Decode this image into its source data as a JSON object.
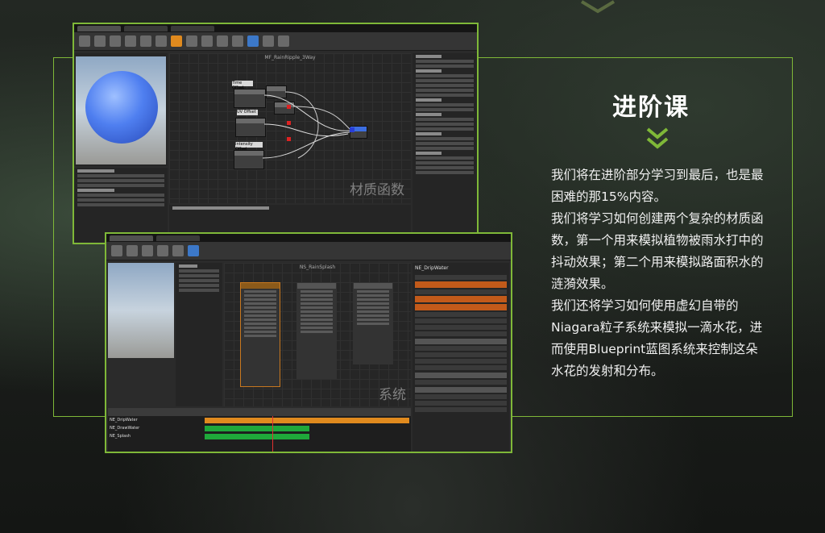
{
  "heading": {
    "title": "进阶课",
    "paragraphs": [
      "我们将在进阶部分学习到最后，也是最困难的那15%内容。",
      "我们将学习如何创建两个复杂的材质函数，第一个用来模拟植物被雨水打中的抖动效果；第二个用来模拟路面积水的涟漪效果。",
      "我们还将学习如何使用虚幻自带的Niagara粒子系统来模拟一滴水花，进而使用Blueprint蓝图系统来控制这朵水花的发射和分布。"
    ]
  },
  "window1": {
    "graph_title": "MF_RainRipple_3Way",
    "watermark": "材质函数",
    "node_labels": [
      "Time Offset",
      "UV Offset",
      "Intensity Offset"
    ]
  },
  "window2": {
    "graph_title": "NS_RainSplash",
    "watermark": "系统",
    "emitter_name": "NE_DripWater",
    "timeline_tracks": [
      "NE_DripWater",
      "NE_DrawWater",
      "NE_Splash"
    ]
  },
  "colors": {
    "accent": "#7fb838",
    "highlight": "#e08a1e",
    "track": "#1fa83a"
  }
}
